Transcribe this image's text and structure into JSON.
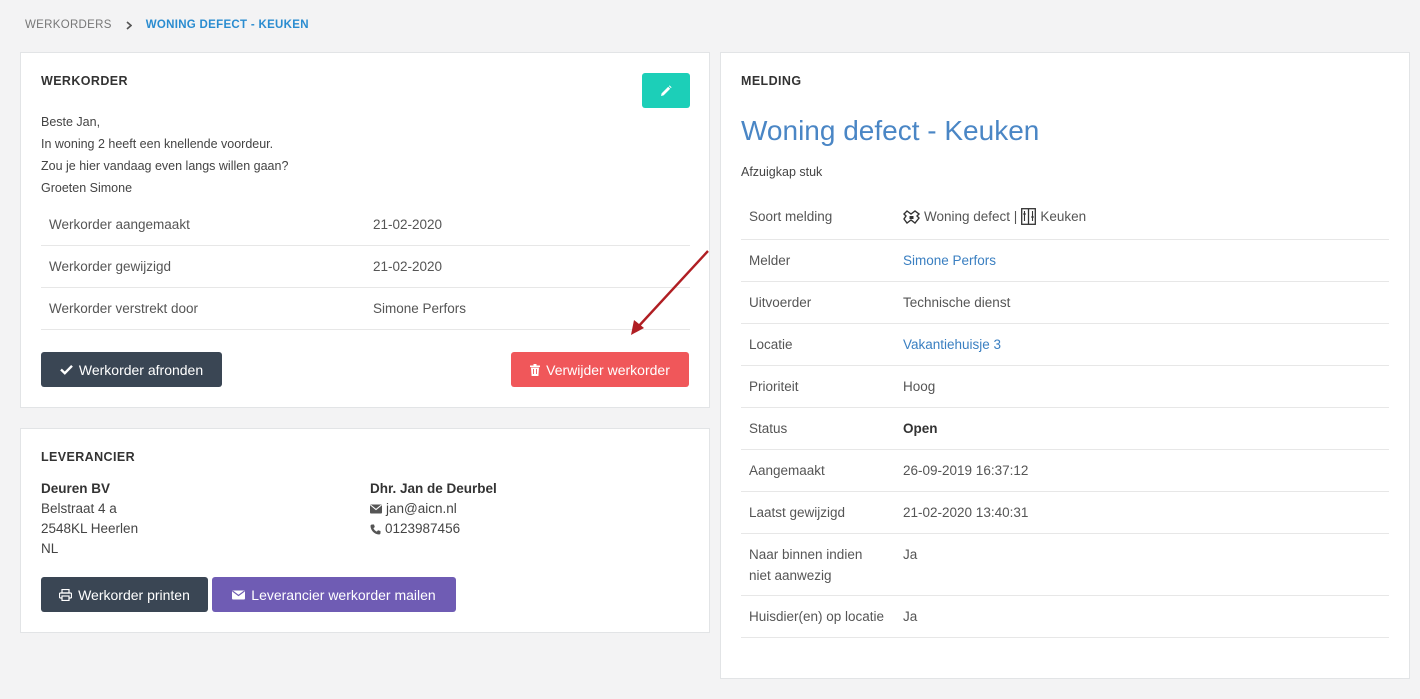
{
  "breadcrumb": {
    "root": "WERKORDERS",
    "current": "WONING DEFECT - KEUKEN"
  },
  "werkorder": {
    "title": "WERKORDER",
    "message": [
      "Beste Jan,",
      "In woning 2 heeft een knellende voordeur.",
      "Zou je hier vandaag even langs willen gaan?",
      "Groeten Simone"
    ],
    "rows": [
      {
        "label": "Werkorder aangemaakt",
        "value": "21-02-2020"
      },
      {
        "label": "Werkorder gewijzigd",
        "value": "21-02-2020"
      },
      {
        "label": "Werkorder verstrekt door",
        "value": "Simone Perfors"
      }
    ],
    "complete_label": "Werkorder afronden",
    "delete_label": "Verwijder werkorder"
  },
  "leverancier": {
    "title": "LEVERANCIER",
    "company": "Deuren BV",
    "street": "Belstraat 4 a",
    "postal_city": "2548KL Heerlen",
    "country": "NL",
    "contact_name": "Dhr. Jan de Deurbel",
    "email": "jan@aicn.nl",
    "phone": "0123987456",
    "print_label": "Werkorder printen",
    "mail_label": "Leverancier werkorder mailen"
  },
  "melding": {
    "title": "MELDING",
    "heading": "Woning defect - Keuken",
    "subtitle": "Afzuigkap stuk",
    "soort_label": "Soort melding",
    "soort_type": "Woning defect |",
    "soort_sub": "Keuken",
    "melder_label": "Melder",
    "melder_value": "Simone Perfors",
    "uitvoerder_label": "Uitvoerder",
    "uitvoerder_value": "Technische dienst",
    "locatie_label": "Locatie",
    "locatie_value": "Vakantiehuisje 3",
    "prioriteit_label": "Prioriteit",
    "prioriteit_value": "Hoog",
    "status_label": "Status",
    "status_value": "Open",
    "aangemaakt_label": "Aangemaakt",
    "aangemaakt_value": "26-09-2019 16:37:12",
    "gewijzigd_label": "Laatst gewijzigd",
    "gewijzigd_value": "21-02-2020 13:40:31",
    "binnen_label": "Naar binnen indien niet aanwezig",
    "binnen_value": "Ja",
    "huisdier_label": "Huisdier(en) op locatie",
    "huisdier_value": "Ja"
  },
  "colors": {
    "accent_teal": "#1ccfb8",
    "danger": "#f0575a",
    "dark": "#3a4654",
    "purple": "#6f5cb4",
    "link": "#3a7fc1",
    "heading": "#4a86c5",
    "annotation_arrow": "#b01e23"
  }
}
